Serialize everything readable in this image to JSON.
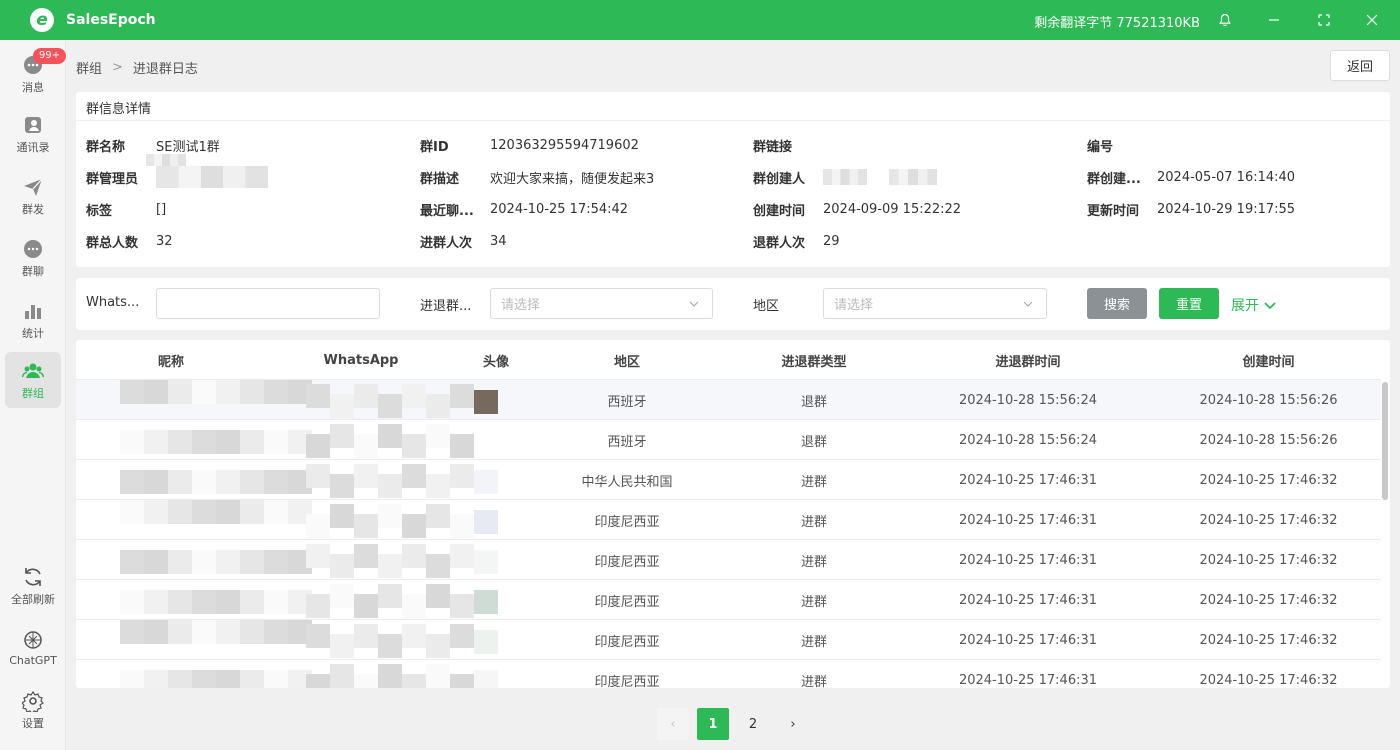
{
  "app": {
    "name": "SalesEpoch",
    "logo_letter": "e",
    "remaining_bytes": "剩余翻译字节 77521310KB"
  },
  "sidebar": {
    "badge": "99+",
    "items": [
      {
        "label": "消息",
        "icon": "chat-bubble-icon"
      },
      {
        "label": "通讯录",
        "icon": "contacts-icon"
      },
      {
        "label": "群发",
        "icon": "paper-plane-icon"
      },
      {
        "label": "群聊",
        "icon": "group-chat-icon"
      },
      {
        "label": "统计",
        "icon": "bar-chart-icon"
      },
      {
        "label": "群组",
        "icon": "users-icon"
      },
      {
        "label": "全部刷新",
        "icon": "refresh-icon"
      },
      {
        "label": "ChatGPT",
        "icon": "chatgpt-icon"
      },
      {
        "label": "设置",
        "icon": "gear-icon"
      }
    ]
  },
  "breadcrumb": {
    "parent": "群组",
    "current": "进退群日志"
  },
  "back_label": "返回",
  "info": {
    "title": "群信息详情",
    "group_name_label": "群名称",
    "group_name": "SE测试1群",
    "group_id_label": "群ID",
    "group_id": "120363295594719602",
    "group_link_label": "群链接",
    "group_link": "",
    "number_label": "编号",
    "number": "",
    "admin_label": "群管理员",
    "desc_label": "群描述",
    "desc": "欢迎大家来搞，随便发起来3",
    "creator_label": "群创建人",
    "created_at_label": "群创建...",
    "created_at": "2024-05-07 16:14:40",
    "tag_label": "标签",
    "tag": "[]",
    "recent_label": "最近聊...",
    "recent": "2024-10-25 17:54:42",
    "create_time_label": "创建时间",
    "create_time": "2024-09-09 15:22:22",
    "update_time_label": "更新时间",
    "update_time": "2024-10-29 19:17:55",
    "total_label": "群总人数",
    "total": "32",
    "join_label": "进群人次",
    "join": "34",
    "leave_label": "退群人次",
    "leave": "29"
  },
  "filter": {
    "whatsapp_label": "Whats...",
    "type_label": "进退群...",
    "type_placeholder": "请选择",
    "region_label": "地区",
    "region_placeholder": "请选择",
    "search": "搜索",
    "reset": "重置",
    "expand": "展开"
  },
  "table": {
    "headers": [
      "昵称",
      "WhatsApp",
      "头像",
      "地区",
      "进退群类型",
      "进退群时间",
      "创建时间"
    ],
    "rows": [
      {
        "region": "西班牙",
        "type": "退群",
        "time": "2024-10-28 15:56:24",
        "created": "2024-10-28 15:56:26"
      },
      {
        "region": "西班牙",
        "type": "退群",
        "time": "2024-10-28 15:56:24",
        "created": "2024-10-28 15:56:26"
      },
      {
        "region": "中华人民共和国",
        "type": "进群",
        "time": "2024-10-25 17:46:31",
        "created": "2024-10-25 17:46:32"
      },
      {
        "region": "印度尼西亚",
        "type": "进群",
        "time": "2024-10-25 17:46:31",
        "created": "2024-10-25 17:46:32"
      },
      {
        "region": "印度尼西亚",
        "type": "进群",
        "time": "2024-10-25 17:46:31",
        "created": "2024-10-25 17:46:32"
      },
      {
        "region": "印度尼西亚",
        "type": "进群",
        "time": "2024-10-25 17:46:31",
        "created": "2024-10-25 17:46:32"
      },
      {
        "region": "印度尼西亚",
        "type": "进群",
        "time": "2024-10-25 17:46:31",
        "created": "2024-10-25 17:46:32"
      },
      {
        "region": "印度尼西亚",
        "type": "进群",
        "time": "2024-10-25 17:46:31",
        "created": "2024-10-25 17:46:32"
      }
    ]
  },
  "pagination": {
    "prev": "‹",
    "pages": [
      "1",
      "2"
    ],
    "current": "1",
    "next": "›"
  },
  "colors": {
    "brand": "#2db955",
    "search_button": "#8c9196",
    "badge": "#f5535a"
  }
}
